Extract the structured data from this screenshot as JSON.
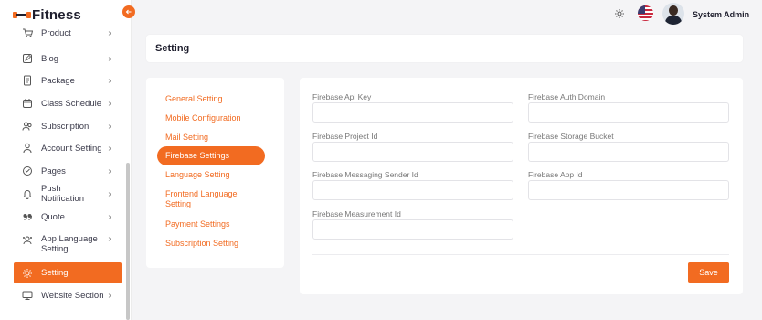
{
  "app": {
    "logo_text": "Fitness"
  },
  "header": {
    "user_name": "System Admin"
  },
  "sidebar": {
    "items": [
      {
        "label": "Product",
        "icon": "cart-icon",
        "chev": "›"
      },
      {
        "label": "Blog",
        "icon": "edit-icon",
        "chev": "›"
      },
      {
        "label": "Package",
        "icon": "document-icon",
        "chev": "›"
      },
      {
        "label": "Class Schedule",
        "icon": "calendar-icon",
        "chev": "›"
      },
      {
        "label": "Subscription",
        "icon": "users-icon",
        "chev": "›"
      },
      {
        "label": "Account Setting",
        "icon": "user-settings-icon",
        "chev": "›"
      },
      {
        "label": "Pages",
        "icon": "pages-icon",
        "chev": "›"
      },
      {
        "label": "Push Notification",
        "icon": "bell-icon",
        "chev": "›"
      },
      {
        "label": "Quote",
        "icon": "quote-icon",
        "chev": "›"
      },
      {
        "label": "App Language Setting",
        "icon": "language-icon",
        "chev": "›"
      },
      {
        "label": "Setting",
        "icon": "gear-icon",
        "chev": ""
      },
      {
        "label": "Website Section",
        "icon": "monitor-icon",
        "chev": "›"
      }
    ]
  },
  "page": {
    "title": "Setting"
  },
  "settings_menu": {
    "items": [
      "General Setting",
      "Mobile Configuration",
      "Mail Setting",
      "Firebase Settings",
      "Language Setting",
      "Frontend Language Setting",
      "Payment Settings",
      "Subscription Setting"
    ],
    "active": "Firebase Settings"
  },
  "form": {
    "api_key_label": "Firebase Api Key",
    "auth_domain_label": "Firebase Auth Domain",
    "project_id_label": "Firebase Project Id",
    "storage_bucket_label": "Firebase Storage Bucket",
    "sender_id_label": "Firebase Messaging Sender Id",
    "app_id_label": "Firebase App Id",
    "measurement_id_label": "Firebase Measurement Id",
    "api_key_value": "",
    "auth_domain_value": "",
    "project_id_value": "",
    "storage_bucket_value": "",
    "sender_id_value": "",
    "app_id_value": "",
    "measurement_id_value": "",
    "save_label": "Save"
  },
  "colors": {
    "accent": "#f26b21",
    "background": "#f4f4f6",
    "text_dark": "#1f1f2e"
  }
}
